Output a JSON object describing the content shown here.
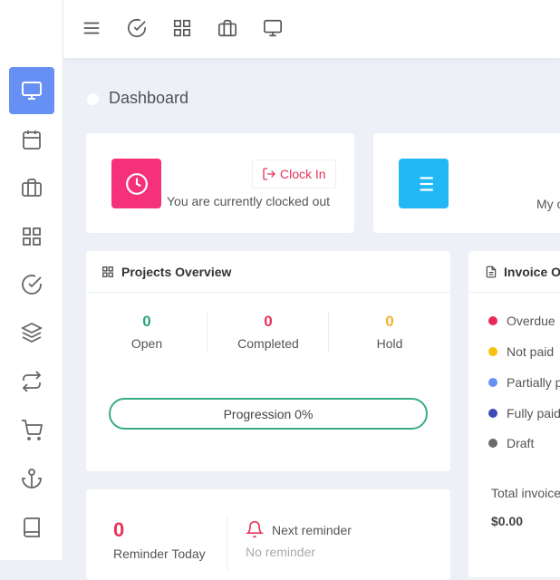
{
  "page": {
    "title": "Dashboard"
  },
  "topbar": {
    "icons": [
      "menu-icon",
      "check-circle-icon",
      "grid-icon",
      "briefcase-icon",
      "monitor-icon"
    ]
  },
  "sidebar": {
    "items": [
      {
        "icon": "monitor-icon",
        "active": true
      },
      {
        "icon": "calendar-icon"
      },
      {
        "icon": "briefcase-icon"
      },
      {
        "icon": "grid-icon"
      },
      {
        "icon": "check-circle-icon"
      },
      {
        "icon": "layers-icon"
      },
      {
        "icon": "repeat-icon"
      },
      {
        "icon": "cart-icon"
      },
      {
        "icon": "anchor-icon"
      },
      {
        "icon": "book-icon"
      }
    ]
  },
  "clock": {
    "button": "Clock In",
    "status": "You are currently clocked out",
    "color": "#f5317a"
  },
  "tasks": {
    "text": "My o",
    "color": "#22b8f5"
  },
  "projects": {
    "title": "Projects Overview",
    "stats": [
      {
        "value": "0",
        "label": "Open",
        "color": "#2aa67a"
      },
      {
        "value": "0",
        "label": "Completed",
        "color": "#e8335a"
      },
      {
        "value": "0",
        "label": "Hold",
        "color": "#f5b52e"
      }
    ],
    "progress_label": "Progression 0%",
    "progress": 0
  },
  "invoice": {
    "title": "Invoice O",
    "legend": [
      {
        "label": "Overdue",
        "color": "#e8285a"
      },
      {
        "label": "Not paid",
        "color": "#f7c10d"
      },
      {
        "label": "Partially p",
        "color": "#6690f4"
      },
      {
        "label": "Fully paid",
        "color": "#3c4bb8"
      },
      {
        "label": "Draft",
        "color": "#6b6b6b"
      }
    ],
    "total_label": "Total invoice",
    "total_value": "$0.00"
  },
  "reminder": {
    "count": "0",
    "count_label": "Reminder Today",
    "next_label": "Next reminder",
    "next_value": "No reminder"
  }
}
